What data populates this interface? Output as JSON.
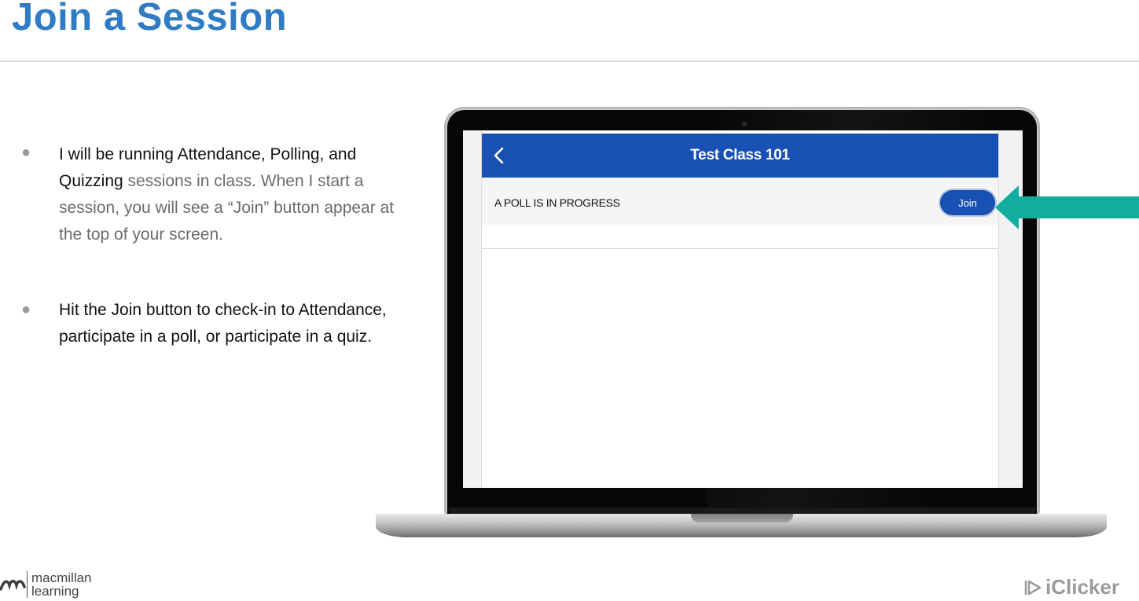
{
  "slide": {
    "title": "Join a Session"
  },
  "bullets": [
    {
      "dark": "I will be running Attendance, Polling, and Quizzing",
      "gray": " sessions in class. When I start a session, you will see a “Join” button appear at the top of your screen."
    },
    {
      "dark": "Hit the Join button to check-in to Attendance, participate in a poll, or participate in a quiz.",
      "gray": ""
    }
  ],
  "app": {
    "header_title": "Test Class 101",
    "poll_status": "A POLL IS IN PROGRESS",
    "join_label": "Join"
  },
  "logos": {
    "left_line1": "macmillan",
    "left_line2": "learning",
    "right": "iClicker"
  },
  "colors": {
    "title": "#2f7bc4",
    "app_header": "#1950b4",
    "arrow": "#12ad9f"
  },
  "icons": [
    "back-chevron-icon",
    "macmillan-logo-icon",
    "iclicker-logo-icon"
  ]
}
